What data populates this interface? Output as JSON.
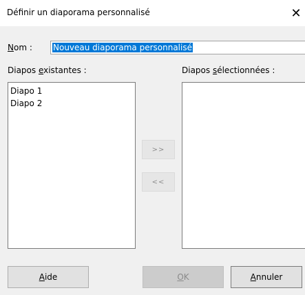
{
  "dialog": {
    "title": "Définir un diaporama personnalisé",
    "close_glyph": "✕"
  },
  "name": {
    "label_access": "N",
    "label_rest": "om :",
    "value": "Nouveau diaporama personnalisé"
  },
  "existing": {
    "label_pre": "Diapos ",
    "label_access": "e",
    "label_post": "xistantes :",
    "items": [
      "Diapo 1",
      "Diapo 2"
    ]
  },
  "selected": {
    "label_pre": "Diapos ",
    "label_access": "s",
    "label_post": "électionnées :",
    "items": []
  },
  "move": {
    "add_label": ">>",
    "remove_label": "<<"
  },
  "buttons": {
    "help_access": "A",
    "help_rest": "ide",
    "ok_access": "O",
    "ok_rest": "K",
    "cancel_access": "A",
    "cancel_rest": "nnuler"
  }
}
